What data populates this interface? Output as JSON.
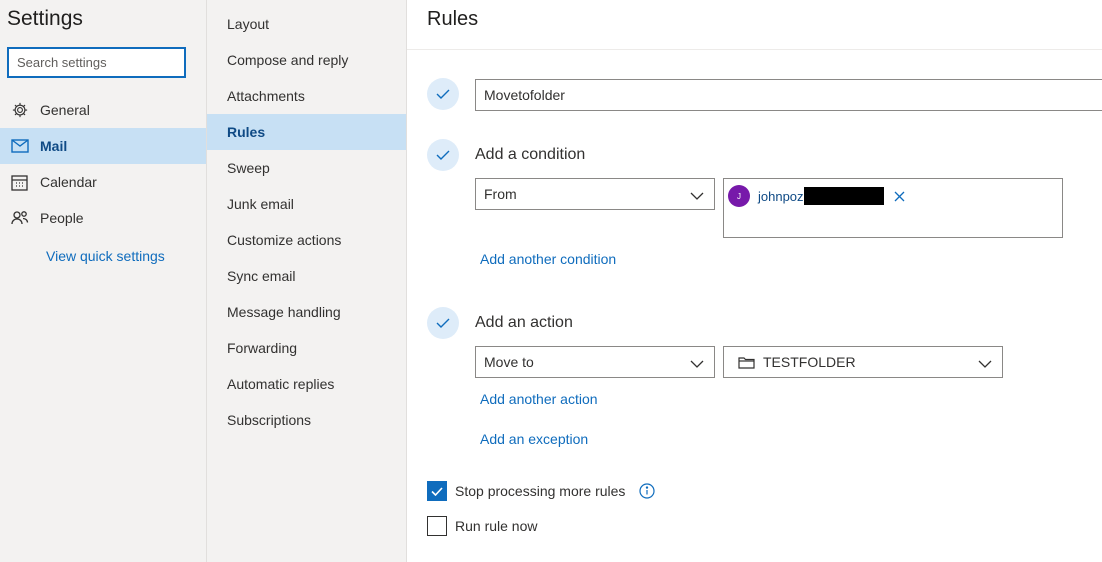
{
  "settings": {
    "title": "Settings",
    "search_placeholder": "Search settings",
    "nav": [
      {
        "label": "General",
        "icon": "gear-icon"
      },
      {
        "label": "Mail",
        "icon": "mail-icon"
      },
      {
        "label": "Calendar",
        "icon": "calendar-icon"
      },
      {
        "label": "People",
        "icon": "people-icon"
      }
    ],
    "quick_link": "View quick settings"
  },
  "mail_menu": {
    "items": [
      "Layout",
      "Compose and reply",
      "Attachments",
      "Rules",
      "Sweep",
      "Junk email",
      "Customize actions",
      "Sync email",
      "Message handling",
      "Forwarding",
      "Automatic replies",
      "Subscriptions"
    ],
    "selected": "Rules"
  },
  "rules": {
    "title": "Rules",
    "rule_name": "Movetofolder",
    "condition": {
      "heading": "Add a condition",
      "type": "From",
      "recipient": {
        "initial": "J",
        "name": "johnpoz",
        "avatar_color": "#7719aa"
      },
      "add_link": "Add another condition"
    },
    "action": {
      "heading": "Add an action",
      "type": "Move to",
      "folder": "TESTFOLDER",
      "add_link": "Add another action",
      "exception_link": "Add an exception"
    },
    "stop_processing": {
      "label": "Stop processing more rules",
      "checked": true
    },
    "run_now": {
      "label": "Run rule now",
      "checked": false
    }
  },
  "colors": {
    "accent": "#0f6cbd",
    "selected_bg": "#c7e0f4",
    "pane_bg": "#f3f2f1"
  }
}
